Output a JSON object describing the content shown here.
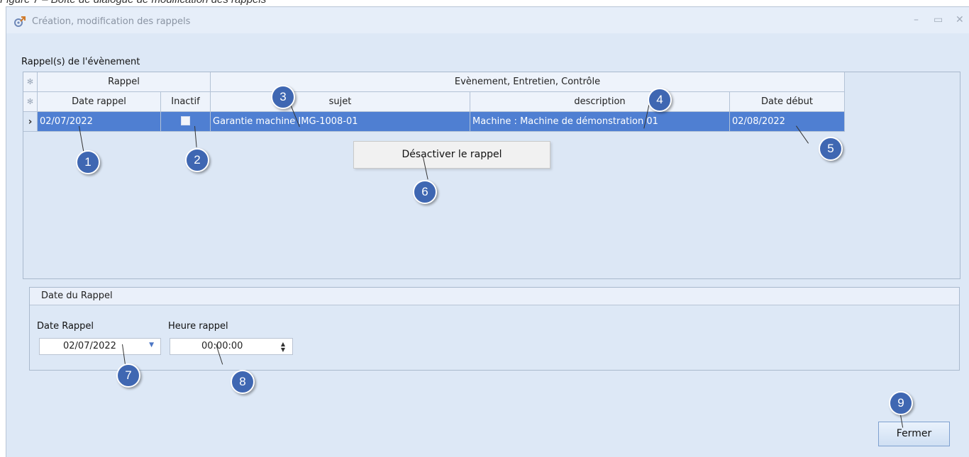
{
  "figure_caption": "Figure 7 – Boîte de dialogue de modification des rappels",
  "window": {
    "title": "Création, modification des rappels",
    "icon": "gear-wrench-icon",
    "controls": [
      "minimize-icon",
      "maximize-icon",
      "close-icon"
    ]
  },
  "grid_section": {
    "label": "Rappel(s) de l'évènement",
    "band_headers": [
      "Rappel",
      "Evènement, Entretien, Contrôle"
    ],
    "columns": [
      "Date rappel",
      "Inactif",
      "sujet",
      "description",
      "Date début"
    ],
    "rows": [
      {
        "date_rappel": "02/07/2022",
        "inactif": false,
        "sujet": "Garantie machine IMG-1008-01",
        "description": "Machine : Machine de démonstration 01",
        "date_debut": "02/08/2022"
      }
    ],
    "context_menu_item": "Désactiver le rappel"
  },
  "date_group": {
    "title": "Date du Rappel",
    "date_label": "Date Rappel",
    "date_value": "02/07/2022",
    "time_label": "Heure rappel",
    "time_value": "00:00:00"
  },
  "close_button": "Fermer",
  "callouts": [
    "1",
    "2",
    "3",
    "4",
    "5",
    "6",
    "7",
    "8",
    "9"
  ],
  "colors": {
    "window_bg": "#dde8f6",
    "selected_row": "#4f7fd2",
    "badge": "#3f67b2"
  }
}
